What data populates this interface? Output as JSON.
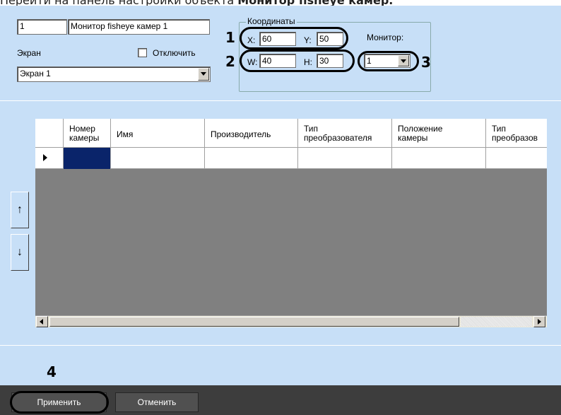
{
  "doc": {
    "heading_prefix": "Перейти на панель настройки объекта ",
    "heading_bold": "Монитор fisheye камер."
  },
  "object": {
    "id": "1",
    "name": "Монитор fisheye камер 1"
  },
  "screen": {
    "label": "Экран",
    "value": "Экран 1"
  },
  "disable": {
    "label": "Отключить",
    "checked": false
  },
  "coords": {
    "group_title": "Координаты",
    "x_label": "X:",
    "x_value": "60",
    "y_label": "Y:",
    "y_value": "50",
    "w_label": "W:",
    "w_value": "40",
    "h_label": "H:",
    "h_value": "30",
    "monitor_label": "Монитор:",
    "monitor_value": "1"
  },
  "markers": {
    "m1": "1",
    "m2": "2",
    "m3": "3",
    "m4": "4"
  },
  "table": {
    "columns": [
      {
        "line1": "Номер",
        "line2": "камеры"
      },
      {
        "line1": "Имя",
        "line2": ""
      },
      {
        "line1": "Производитель",
        "line2": ""
      },
      {
        "line1": "Тип",
        "line2": "преобразователя"
      },
      {
        "line1": "Положение",
        "line2": "камеры"
      },
      {
        "line1": "Тип",
        "line2": "преобразов"
      }
    ]
  },
  "move": {
    "up": "↑",
    "down": "↓"
  },
  "buttons": {
    "apply": "Применить",
    "cancel": "Отменить"
  },
  "colors": {
    "panel_bg": "#c7dff7",
    "selection": "#0a246a",
    "bottom_bar": "#3d3d3d"
  }
}
